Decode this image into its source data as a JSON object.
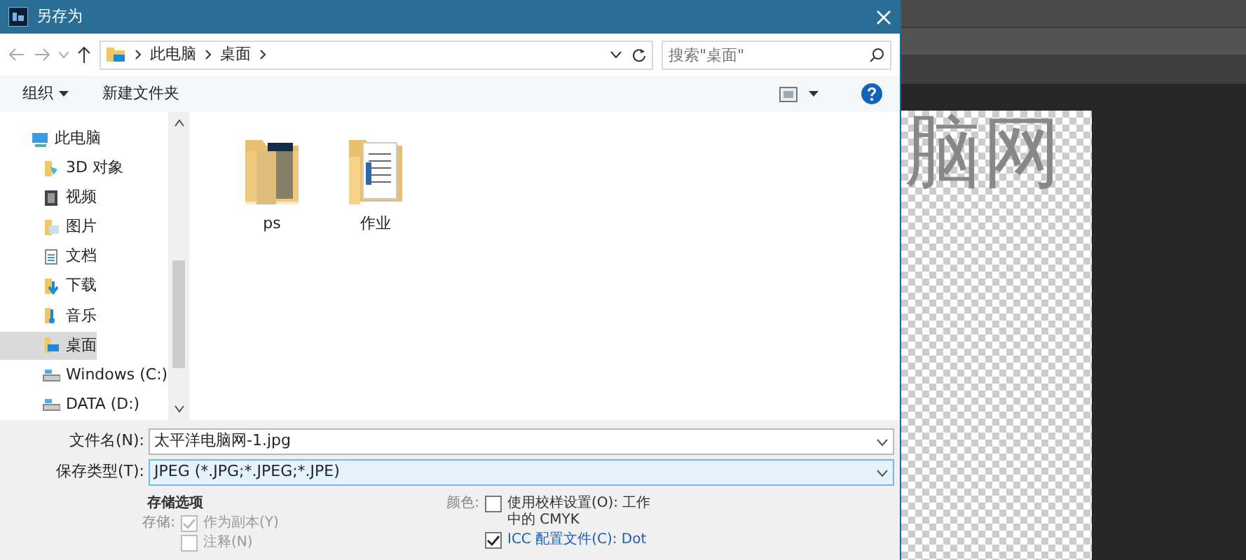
{
  "window": {
    "title": "另存为"
  },
  "address": {
    "crumbs": [
      "此电脑",
      "桌面"
    ],
    "search_placeholder": "搜索\"桌面\""
  },
  "toolbar": {
    "organize": "组织",
    "new_folder": "新建文件夹"
  },
  "sidebar": {
    "items": [
      {
        "label": "此电脑",
        "kind": "pc",
        "selected": false,
        "children": [
          {
            "label": "3D 对象",
            "kind": "objects",
            "selected": false
          },
          {
            "label": "视频",
            "kind": "video",
            "selected": false
          },
          {
            "label": "图片",
            "kind": "pictures",
            "selected": false
          },
          {
            "label": "文档",
            "kind": "documents",
            "selected": false
          },
          {
            "label": "下载",
            "kind": "downloads",
            "selected": false
          },
          {
            "label": "音乐",
            "kind": "music",
            "selected": false
          },
          {
            "label": "桌面",
            "kind": "desktop",
            "selected": true
          },
          {
            "label": "Windows (C:)",
            "kind": "drive",
            "selected": false
          },
          {
            "label": "DATA (D:)",
            "kind": "drive",
            "selected": false
          }
        ]
      }
    ]
  },
  "files": [
    {
      "name": "ps",
      "kind": "ps-folder"
    },
    {
      "name": "作业",
      "kind": "doc-folder"
    }
  ],
  "form": {
    "filename_label": "文件名(N):",
    "filename": "太平洋电脑网-1.jpg",
    "type_label": "保存类型(T):",
    "type": "JPEG (*.JPG;*.JPEG;*.JPE)"
  },
  "options": {
    "heading": "存储选项",
    "save_label": "存储:",
    "color_label": "颜色:",
    "left": [
      {
        "label": "作为副本(Y)",
        "checked": true,
        "disabled": true
      },
      {
        "label": "注释(N)",
        "checked": false,
        "disabled": true
      }
    ],
    "right": [
      {
        "label": "使用校样设置(O): 工作中的 CMYK",
        "checked": false,
        "disabled": false,
        "link": false
      },
      {
        "label": "ICC 配置文件(C): Dot",
        "checked": true,
        "disabled": false,
        "link": true
      }
    ]
  },
  "canvas": {
    "text": "脑网"
  }
}
